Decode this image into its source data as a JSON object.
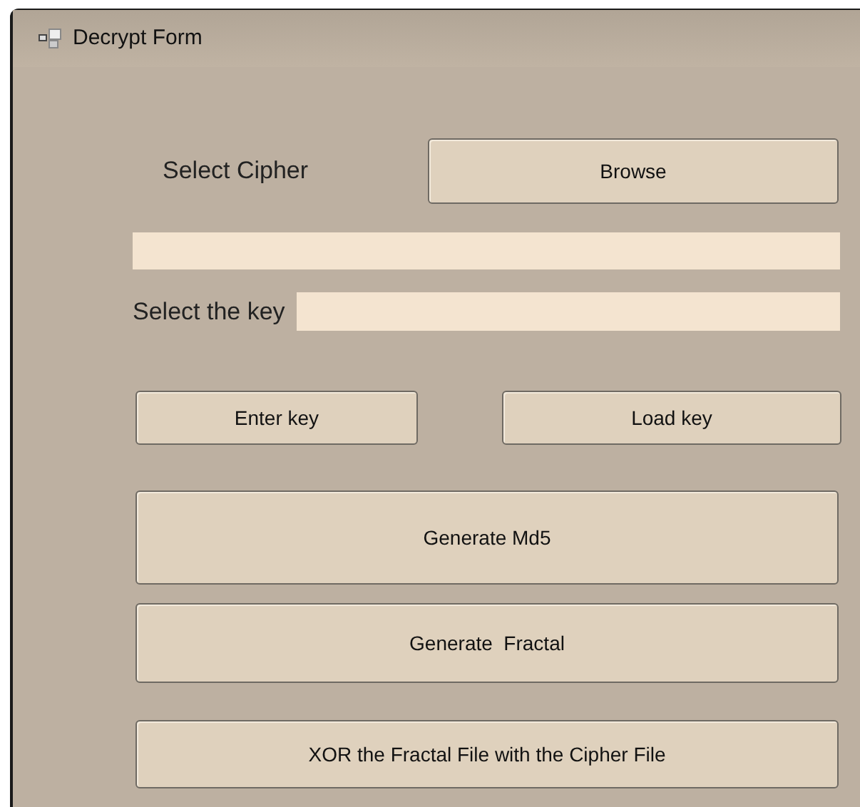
{
  "window": {
    "title": "Decrypt Form"
  },
  "cipher": {
    "label": "Select Cipher",
    "browse_button": "Browse"
  },
  "key": {
    "label": "Select the key"
  },
  "key_buttons": [
    "Enter key",
    "Load key"
  ],
  "action_buttons": [
    {
      "label": "Generate Md5",
      "kind": "tall"
    },
    {
      "label": "Generate  Fractal",
      "kind": "medium"
    },
    {
      "label": "XOR the Fractal File with the Cipher File",
      "kind": "short"
    }
  ]
}
